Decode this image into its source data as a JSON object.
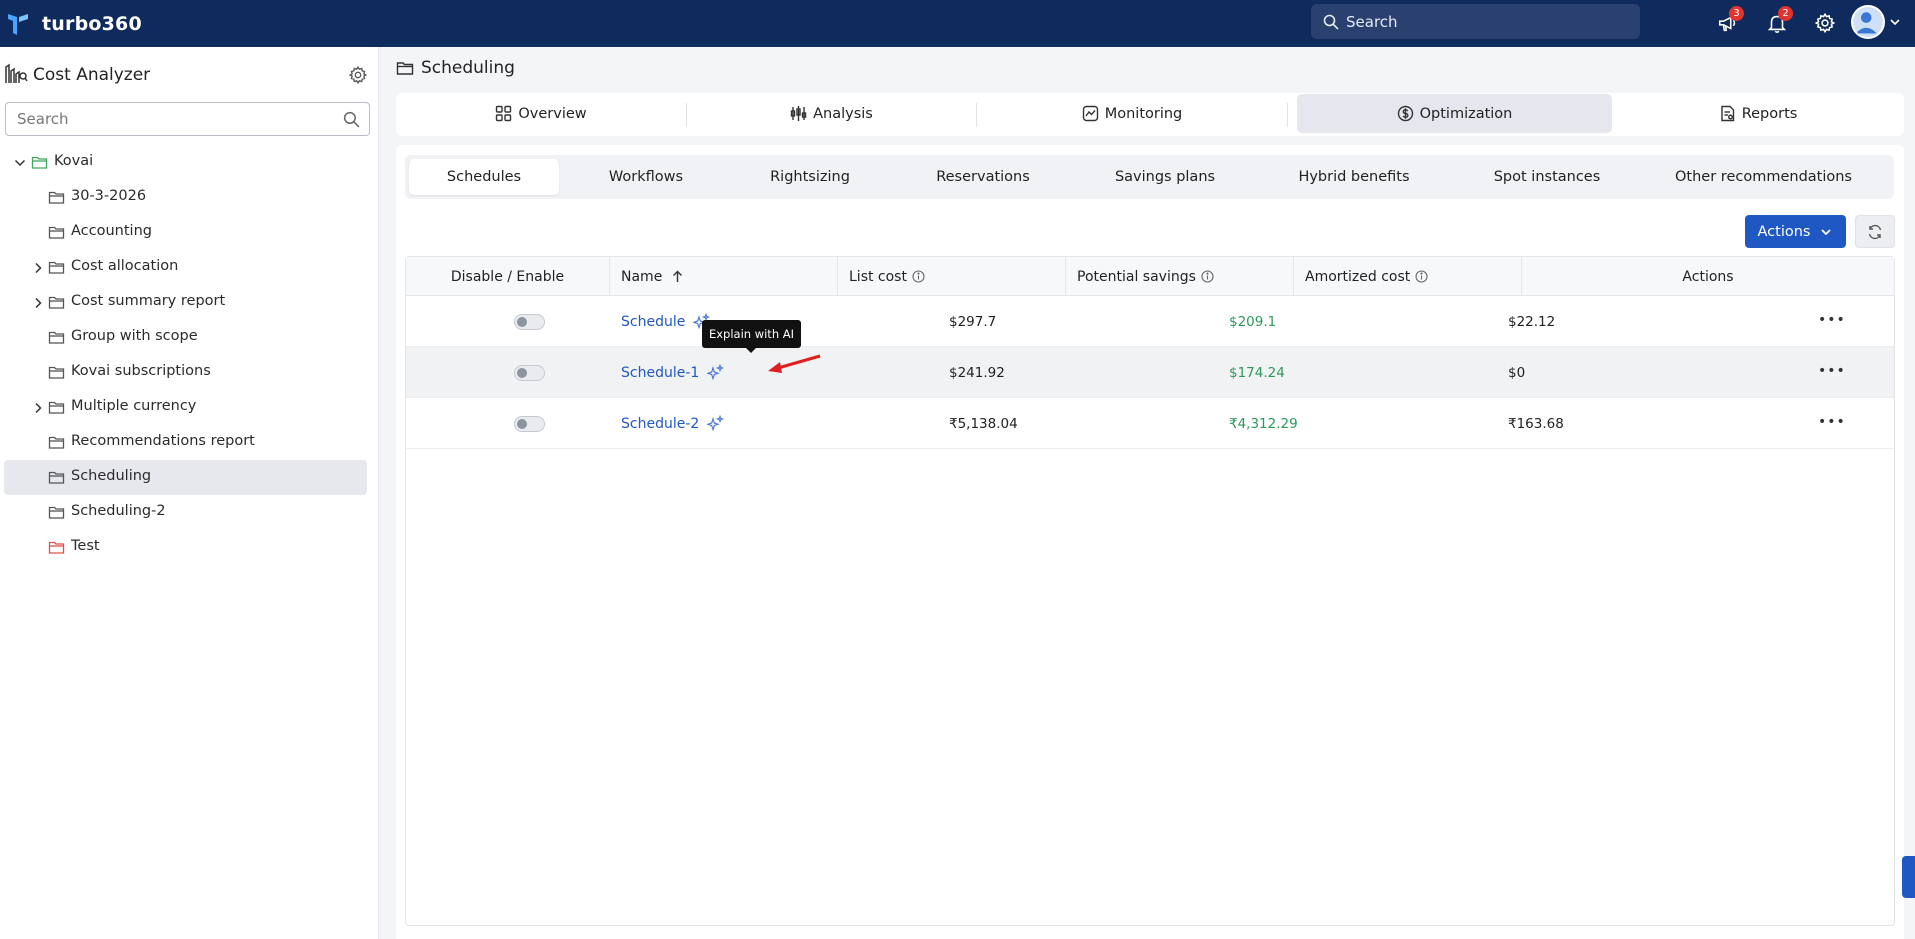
{
  "topbar": {
    "brand": "turbo360",
    "search_placeholder": "Search",
    "announcements_count": "3",
    "notifications_count": "2"
  },
  "sidebar": {
    "title": "Cost Analyzer",
    "search_placeholder": "Search",
    "tree": [
      {
        "label": "Kovai",
        "expandable": true,
        "expanded": true,
        "folder_color": "#3fa95b"
      },
      {
        "label": "30-3-2026",
        "expandable": false,
        "folder_color": "#555555"
      },
      {
        "label": "Accounting",
        "expandable": false,
        "folder_color": "#555555"
      },
      {
        "label": "Cost allocation",
        "expandable": true,
        "folder_color": "#555555"
      },
      {
        "label": "Cost summary report",
        "expandable": true,
        "folder_color": "#555555"
      },
      {
        "label": "Group with scope",
        "expandable": false,
        "folder_color": "#555555"
      },
      {
        "label": "Kovai subscriptions",
        "expandable": false,
        "folder_color": "#555555"
      },
      {
        "label": "Multiple currency",
        "expandable": true,
        "folder_color": "#555555"
      },
      {
        "label": "Recommendations report",
        "expandable": false,
        "folder_color": "#555555"
      },
      {
        "label": "Scheduling",
        "expandable": false,
        "selected": true,
        "folder_color": "#555555"
      },
      {
        "label": "Scheduling-2",
        "expandable": false,
        "folder_color": "#555555"
      },
      {
        "label": "Test",
        "expandable": false,
        "folder_color": "#e0504a"
      }
    ]
  },
  "breadcrumb": "Scheduling",
  "main_tabs": [
    {
      "label": "Overview",
      "icon": "grid-icon"
    },
    {
      "label": "Analysis",
      "icon": "analysis-icon"
    },
    {
      "label": "Monitoring",
      "icon": "monitoring-icon"
    },
    {
      "label": "Optimization",
      "icon": "dollar-icon",
      "active": true
    },
    {
      "label": "Reports",
      "icon": "reports-icon"
    }
  ],
  "sub_tabs": [
    {
      "label": "Schedules",
      "active": true
    },
    {
      "label": "Workflows"
    },
    {
      "label": "Rightsizing"
    },
    {
      "label": "Reservations"
    },
    {
      "label": "Savings plans"
    },
    {
      "label": "Hybrid benefits"
    },
    {
      "label": "Spot instances"
    },
    {
      "label": "Other recommendations"
    }
  ],
  "toolbar": {
    "actions_label": "Actions"
  },
  "table": {
    "columns": [
      "Disable / Enable",
      "Name",
      "List cost",
      "Potential savings",
      "Amortized cost",
      "Actions"
    ],
    "rows": [
      {
        "name": "Schedule",
        "list_cost": "$297.7",
        "potential_savings": "$209.1",
        "amortized_cost": "$22.12",
        "enabled": false
      },
      {
        "name": "Schedule-1",
        "list_cost": "$241.92",
        "potential_savings": "$174.24",
        "amortized_cost": "$0",
        "enabled": false
      },
      {
        "name": "Schedule-2",
        "list_cost": "₹5,138.04",
        "potential_savings": "₹4,312.29",
        "amortized_cost": "₹163.68",
        "enabled": false
      }
    ]
  },
  "tooltip": "Explain with AI",
  "colors": {
    "topbar": "#0f2a5c",
    "primary": "#1f57c3",
    "savings_green": "#2b9a59",
    "annotation_arrow": "#e02020"
  }
}
